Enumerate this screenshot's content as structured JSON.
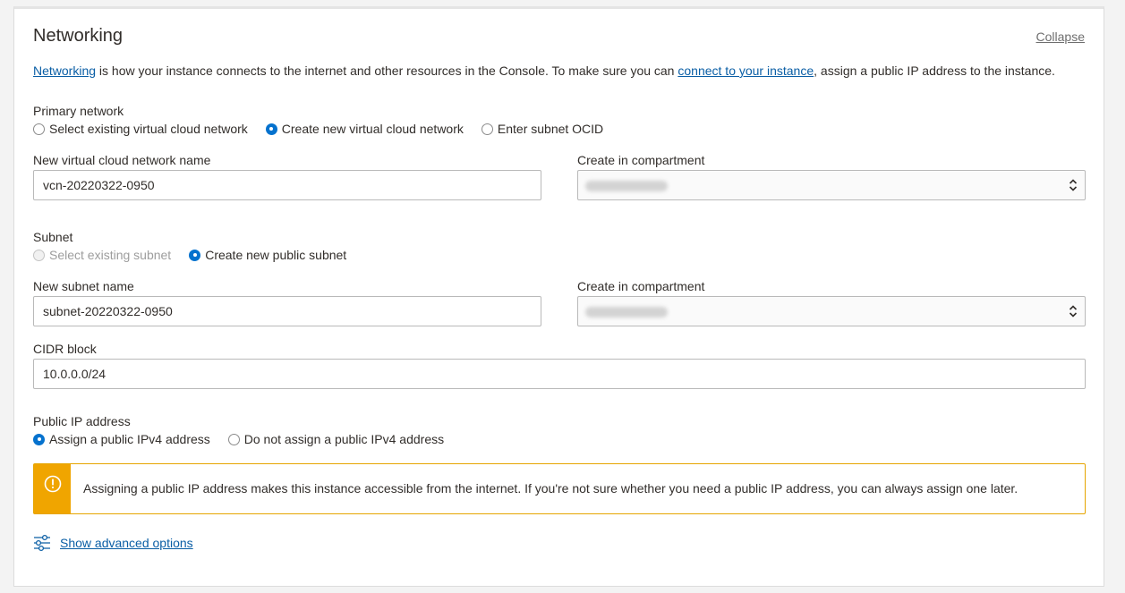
{
  "section": {
    "title": "Networking",
    "collapse_label": "Collapse"
  },
  "intro": {
    "link1": "Networking",
    "text1": " is how your instance connects to the internet and other resources in the Console. To make sure you can ",
    "link2": "connect to your instance",
    "text2": ", assign a public IP address to the instance."
  },
  "primary_network": {
    "label": "Primary network",
    "options": [
      {
        "label": "Select existing virtual cloud network",
        "selected": false
      },
      {
        "label": "Create new virtual cloud network",
        "selected": true
      },
      {
        "label": "Enter subnet OCID",
        "selected": false
      }
    ]
  },
  "vcn_name": {
    "label": "New virtual cloud network name",
    "value": "vcn-20220322-0950"
  },
  "vcn_compartment": {
    "label": "Create in compartment"
  },
  "subnet": {
    "label": "Subnet",
    "options": [
      {
        "label": "Select existing subnet",
        "selected": false,
        "disabled": true
      },
      {
        "label": "Create new public subnet",
        "selected": true
      }
    ]
  },
  "subnet_name": {
    "label": "New subnet name",
    "value": "subnet-20220322-0950"
  },
  "subnet_compartment": {
    "label": "Create in compartment"
  },
  "cidr": {
    "label": "CIDR block",
    "value": "10.0.0.0/24"
  },
  "public_ip": {
    "label": "Public IP address",
    "options": [
      {
        "label": "Assign a public IPv4 address",
        "selected": true
      },
      {
        "label": "Do not assign a public IPv4 address",
        "selected": false
      }
    ]
  },
  "alert": {
    "icon": "warning-icon",
    "message": "Assigning a public IP address makes this instance accessible from the internet. If you're not sure whether you need a public IP address, you can always assign one later."
  },
  "advanced": {
    "icon": "sliders-icon",
    "label": "Show advanced options"
  },
  "colors": {
    "link": "#0a5ea5",
    "radio_selected": "#0572ce",
    "warning": "#f0a500"
  }
}
